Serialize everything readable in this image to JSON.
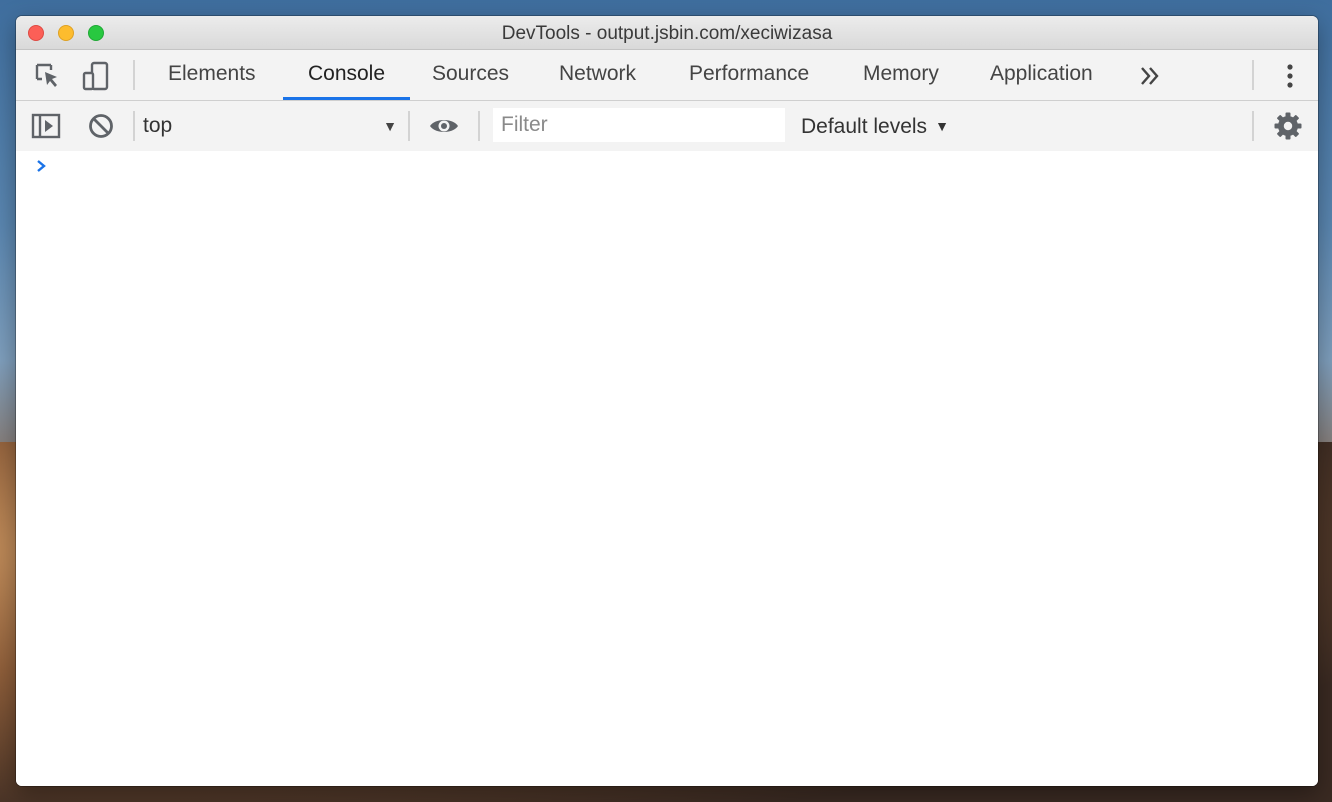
{
  "window": {
    "title": "DevTools - output.jsbin.com/xeciwizasa"
  },
  "tabs": [
    {
      "label": "Elements",
      "active": false
    },
    {
      "label": "Console",
      "active": true
    },
    {
      "label": "Sources",
      "active": false
    },
    {
      "label": "Network",
      "active": false
    },
    {
      "label": "Performance",
      "active": false
    },
    {
      "label": "Memory",
      "active": false
    },
    {
      "label": "Application",
      "active": false
    }
  ],
  "toolbar": {
    "context_value": "top",
    "filter_placeholder": "Filter",
    "filter_value": "",
    "levels_label": "Default levels"
  },
  "icons": {
    "inspect": "inspect-element-icon",
    "device": "device-toolbar-icon",
    "more_tabs": "chevron-double-right-icon",
    "menu": "kebab-menu-icon",
    "sidebar": "sidebar-toggle-icon",
    "clear": "clear-console-icon",
    "eye": "eye-icon",
    "settings": "gear-icon",
    "prompt": "console-prompt-icon"
  },
  "colors": {
    "accent": "#1a73e8",
    "prompt": "#1a73e8"
  }
}
